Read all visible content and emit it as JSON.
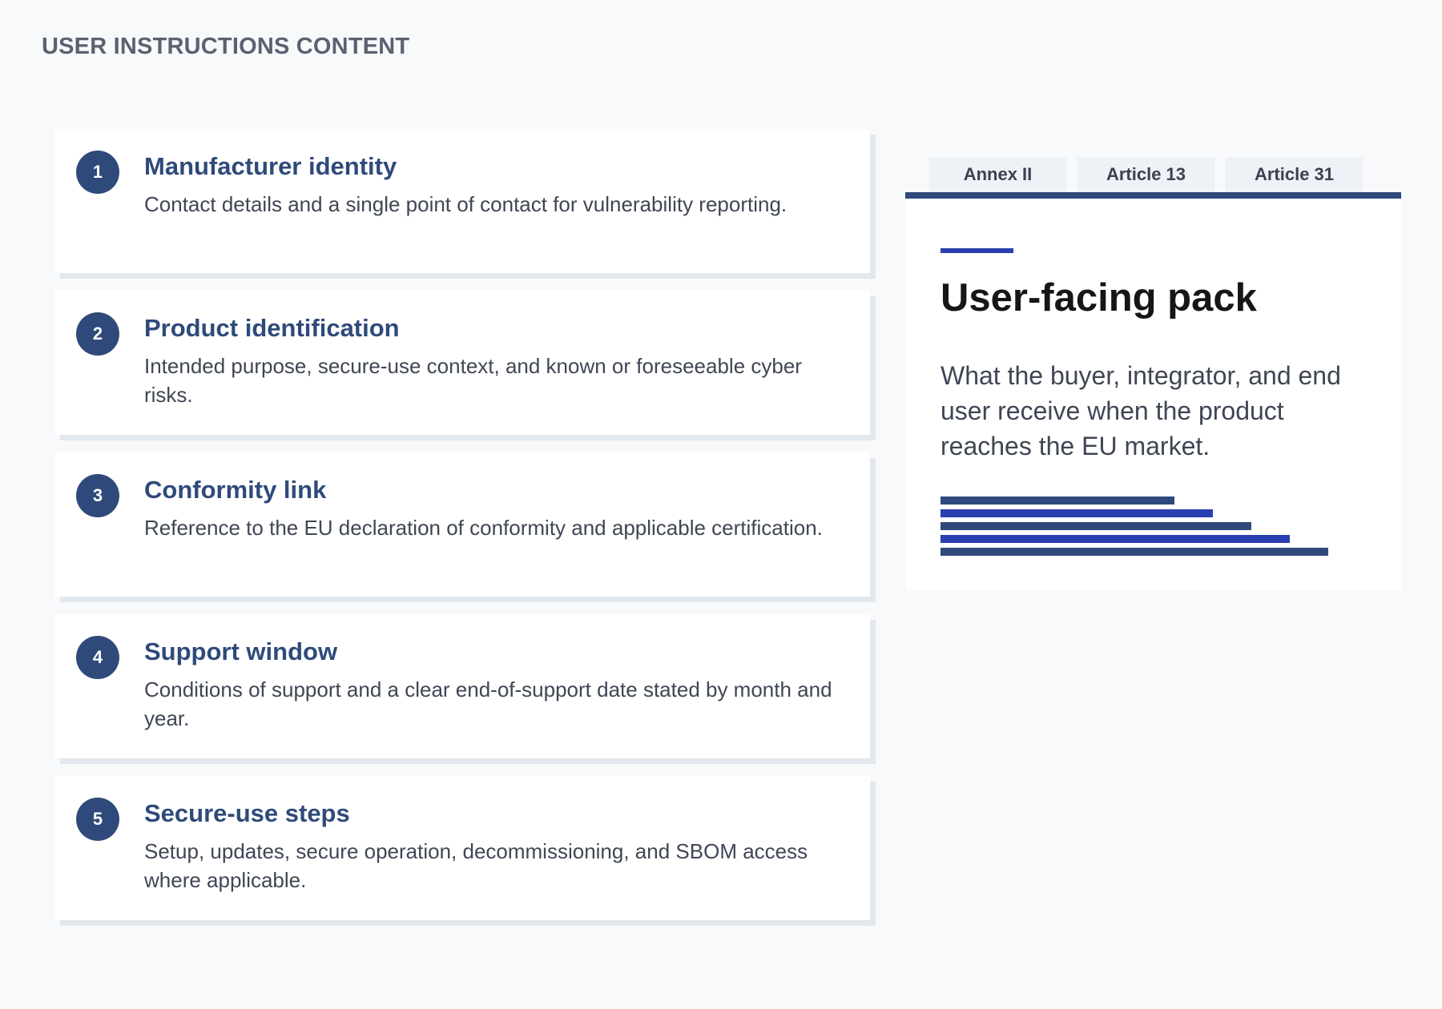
{
  "header": {
    "title": "USER INSTRUCTIONS CONTENT"
  },
  "steps": [
    {
      "number": "1",
      "title": "Manufacturer identity",
      "description": "Contact details and a single point of contact for vulnerability reporting."
    },
    {
      "number": "2",
      "title": "Product identification",
      "description": "Intended purpose, secure-use context, and known or foreseeable cyber risks."
    },
    {
      "number": "3",
      "title": "Conformity link",
      "description": "Reference to the EU declaration of conformity and applicable certification."
    },
    {
      "number": "4",
      "title": "Support window",
      "description": "Conditions of support and a clear end-of-support date stated by month and year."
    },
    {
      "number": "5",
      "title": "Secure-use steps",
      "description": "Setup, updates, secure operation, decommissioning, and SBOM access where applicable."
    }
  ],
  "tabs": [
    {
      "label": "Annex II"
    },
    {
      "label": "Article 13"
    },
    {
      "label": "Article 31"
    }
  ],
  "panel": {
    "title": "User-facing pack",
    "text": "What the buyer, integrator, and end user receive when the product reaches the EU market."
  },
  "colors": {
    "primary": "#2f4a7a",
    "accent": "#2a3fb0",
    "background": "#f8f9fb"
  }
}
